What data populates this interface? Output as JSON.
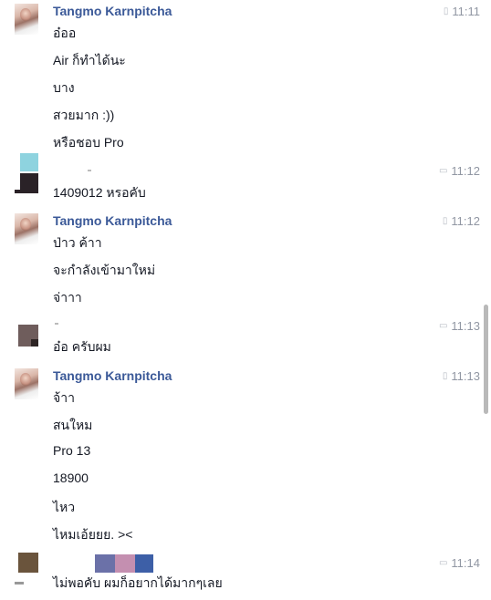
{
  "messages": [
    {
      "sender": "Tangmo Karnpitcha",
      "time": "11:11",
      "time_icon": "mobile-icon",
      "lines": [
        "อ๋ออ",
        "Air ก็ทำได้นะ",
        "บาง",
        "สวยมาก :))",
        "หรือชอบ Pro"
      ]
    },
    {
      "sender": "",
      "time": "11:12",
      "time_icon": "chat-bubble-icon",
      "lines": [
        "1409012 หรอคับ"
      ]
    },
    {
      "sender": "Tangmo Karnpitcha",
      "time": "11:12",
      "time_icon": "mobile-icon",
      "lines": [
        "ป่าว ค้าา",
        "จะกำลังเข้ามาใหม่",
        "จ่าาา"
      ]
    },
    {
      "sender": "",
      "time": "11:13",
      "time_icon": "chat-bubble-icon",
      "lines": [
        "อ๋อ ครับผม"
      ]
    },
    {
      "sender": "Tangmo Karnpitcha",
      "time": "11:13",
      "time_icon": "mobile-icon",
      "lines": [
        "จ้าา",
        "สนใหม",
        "Pro 13",
        "18900",
        "ไหว",
        "ไหมเอ้ยยย. ><"
      ]
    },
    {
      "sender": "",
      "time": "11:14",
      "time_icon": "chat-bubble-icon",
      "lines": [
        "ไม่พอคับ ผมก็อยากได้มากๆเลย"
      ]
    }
  ],
  "colors": {
    "sender_name": "#3b5998",
    "timestamp": "#9197a3",
    "message_text": "#141823",
    "scrollbar_thumb": "#b9b9b9"
  }
}
